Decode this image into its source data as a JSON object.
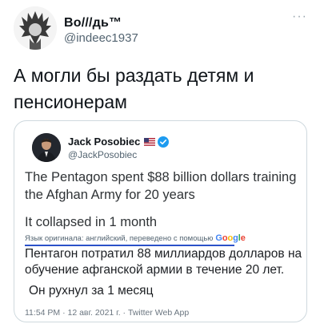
{
  "outer": {
    "name": "Во///дь™",
    "handle": "@indeec1937",
    "more": "···",
    "text": "А могли бы раздать детям и пенсионерам"
  },
  "quoted": {
    "name": "Jack Posobiec",
    "handle": "@JackPosobiec",
    "text_line1": "The Pentagon spent $88 billion dollars training the Afghan Army for 20 years",
    "text_line2": "It collapsed in 1 month",
    "translate_label": "Язык оригинала: английский, переведено с помощью",
    "google": [
      "G",
      "o",
      "o",
      "g",
      "l",
      "e"
    ],
    "translated_line1": "Пентагон потратил 88 миллиардов долларов на обучение афганской армии в течение 20 лет.",
    "translated_line2": "Он рухнул за 1 месяц",
    "meta": "11:54 PM · 12 авг. 2021 г. · Twitter Web App"
  },
  "colors": {
    "verified": "#1d9bf0",
    "translate_rule": "#2b52c9",
    "google_blue": "#4285f4",
    "google_red": "#ea4335",
    "google_yellow": "#fbbc05",
    "google_green": "#34a853"
  },
  "icons": [
    "outer-avatar",
    "more-icon",
    "inner-avatar",
    "us-flag-icon",
    "verified-badge-icon"
  ]
}
